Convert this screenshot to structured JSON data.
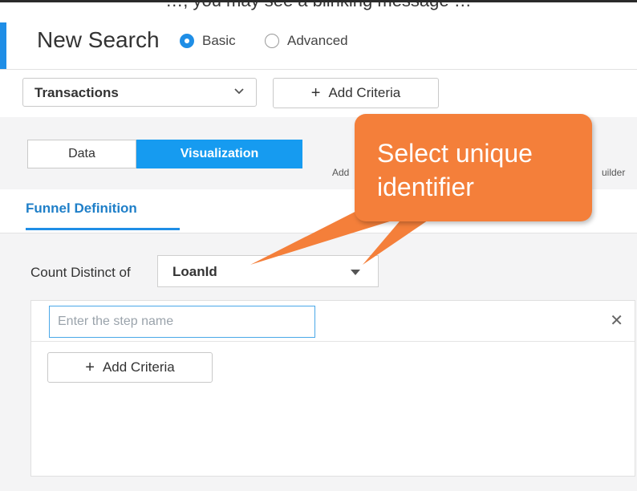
{
  "caption_fragment": "…, you may see a blinking message …",
  "header": {
    "title": "New Search",
    "mode_options": [
      {
        "label": "Basic",
        "selected": true
      },
      {
        "label": "Advanced",
        "selected": false
      }
    ]
  },
  "toolbar": {
    "source_select": "Transactions",
    "add_criteria_label": "Add Criteria"
  },
  "view_toggle": {
    "data_label": "Data",
    "visualization_label": "Visualization",
    "active": "Visualization"
  },
  "partial_texts": {
    "add_fragment": "Add",
    "builder_fragment": "uilder"
  },
  "tabs": {
    "funnel_definition": "Funnel Definition"
  },
  "count_distinct": {
    "label": "Count Distinct of",
    "value": "LoanId"
  },
  "step": {
    "name_placeholder": "Enter the step name",
    "add_criteria_label": "Add Criteria"
  },
  "callout": {
    "text": "Select unique identifier",
    "color": "#f47f3a"
  },
  "colors": {
    "accent": "#1f8ee6",
    "active_segment": "#169bf0"
  },
  "icons": {
    "close": "close-icon",
    "dropdown": "chevron-down-icon",
    "plus": "plus-icon"
  }
}
